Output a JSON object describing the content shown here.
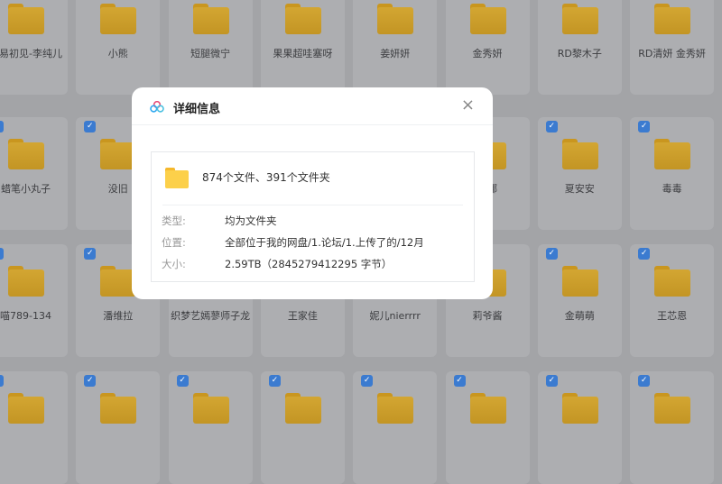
{
  "grid": {
    "rows": [
      [
        "遇易初见-李纯儿",
        "小熊",
        "短腿微宁",
        "果果超哇塞呀",
        "姜妍妍",
        "金秀妍",
        "RD黎木子",
        "RD清妍 金秀妍"
      ],
      [
        "蜡笔小丸子",
        "没旧",
        "",
        "",
        "",
        "米娜",
        "夏安安",
        "毒毒"
      ],
      [
        "喵789-134",
        "潘维拉",
        "织梦艺嫣蓼师子龙",
        "王家佳",
        "妮儿nierrrr",
        "莉爷酱",
        "金萌萌",
        "王芯恩"
      ],
      [
        "",
        "",
        "",
        "",
        "",
        "",
        "",
        ""
      ]
    ]
  },
  "dialog": {
    "title": "详细信息",
    "close": "×",
    "count": "874个文件、391个文件夹",
    "rows": [
      {
        "k": "类型:",
        "v": "均为文件夹"
      },
      {
        "k": "位置:",
        "v": "全部位于我的网盘/1.论坛/1.上传了的/12月"
      },
      {
        "k": "大小:",
        "v": "2.59TB（2845279412295 字节）"
      }
    ]
  },
  "colors": {
    "accent": "#3b7bd0",
    "folder": "#fcd04a"
  }
}
